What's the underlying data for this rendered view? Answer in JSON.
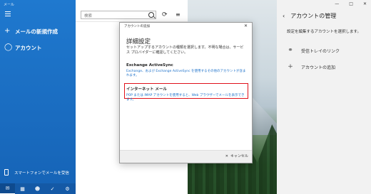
{
  "app": {
    "title": "メール"
  },
  "left_nav": {
    "compose_label": "メールの新規作成",
    "account_label": "アカウント",
    "sms_label": "スマートフォンでメールを受信"
  },
  "search": {
    "placeholder": "検索"
  },
  "right_panel": {
    "title": "アカウントの管理",
    "description": "設定を編集するアカウントを選択します。",
    "link_inbox": "受信トレイのリンク",
    "add_account": "アカウントの追加"
  },
  "dialog": {
    "title": "アカウントの追加",
    "heading": "詳細設定",
    "description": "セットアップするアカウントの種類を選択します。不明な場合は、サービス プロバイダーに確認してください。",
    "options": [
      {
        "name": "Exchange ActiveSync",
        "sub": "Exchange、および Exchange ActiveSync を使用するその他のアカウントが含まれます。"
      },
      {
        "name": "インターネット メール",
        "sub": "POP または IMAP アカウントを使用すると、Web ブラウザーでメールを表示できます。"
      }
    ],
    "cancel_label": "キャンセル"
  },
  "colors": {
    "accent": "#1a6fc9",
    "highlight": "#e0101a",
    "nav_bg": "#1f79cf"
  }
}
